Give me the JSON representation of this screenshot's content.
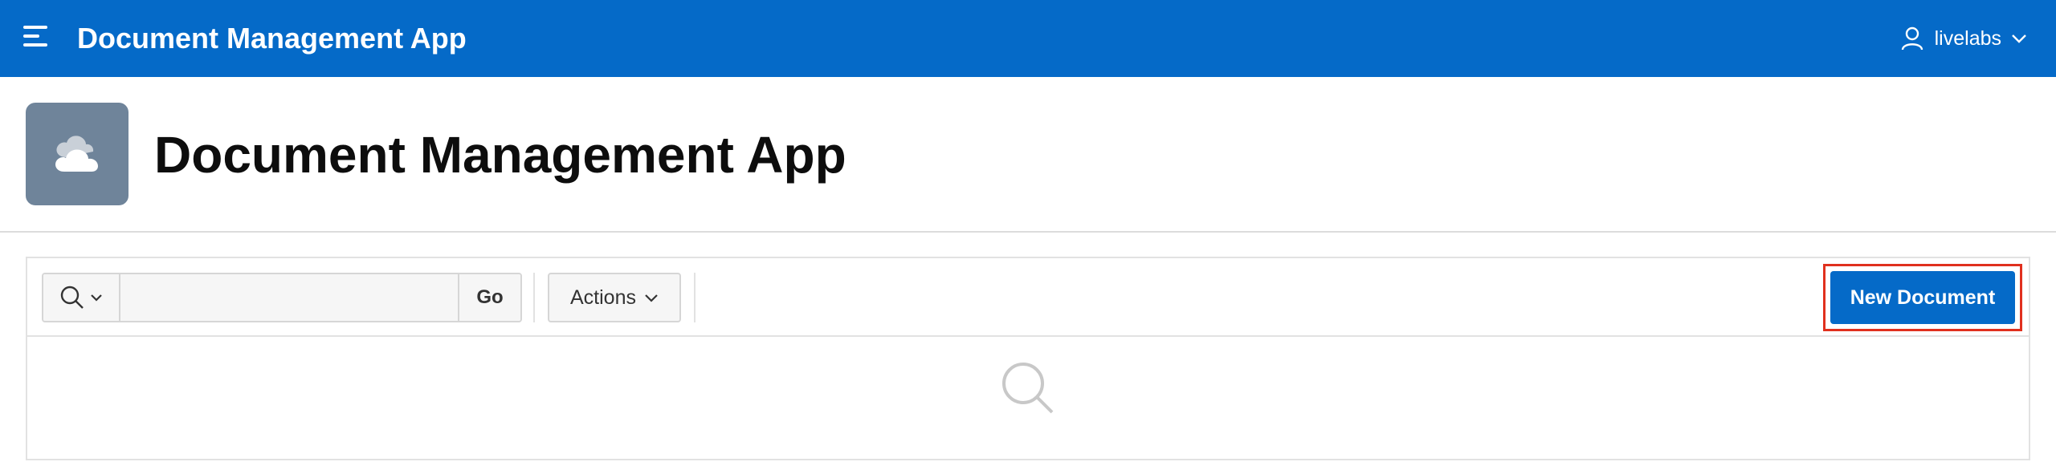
{
  "header": {
    "app_name": "Document Management App",
    "user_name": "livelabs",
    "menu_icon": "hamburger-menu-icon",
    "user_icon": "user-icon"
  },
  "hero": {
    "title": "Document Management App",
    "icon": "cloud-icon"
  },
  "toolbar": {
    "search_value": "",
    "search_placeholder": "",
    "go_label": "Go",
    "actions_label": "Actions",
    "new_document_label": "New Document"
  },
  "report": {
    "empty_icon": "search-icon"
  },
  "colors": {
    "brand_blue": "#056ac8",
    "hero_icon_bg": "#6f849a",
    "highlight": "#e0301e"
  }
}
